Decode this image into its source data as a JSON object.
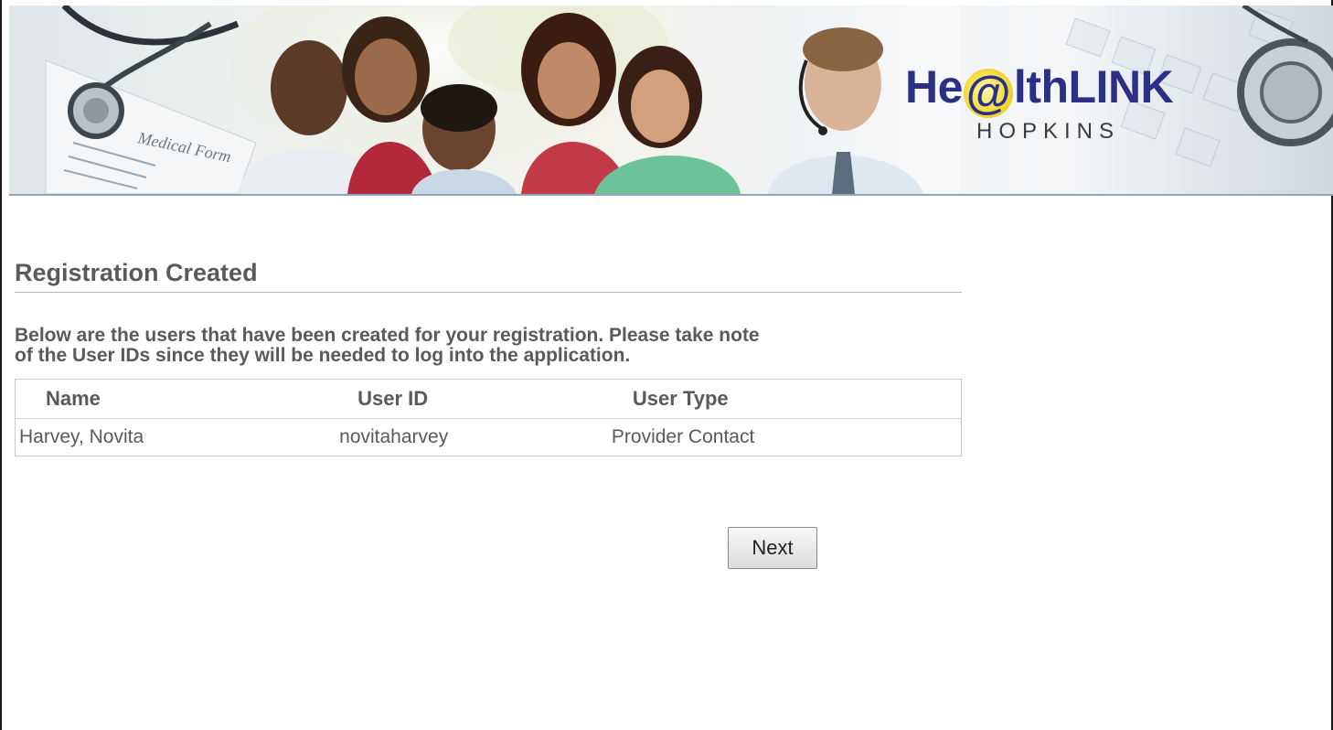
{
  "header": {
    "logo_main_prefix": "He",
    "logo_at": "@",
    "logo_main_suffix": "lthLINK",
    "logo_sub": "HOPKINS",
    "photo_caption": "Medical Form",
    "brand_color": "#2b2f86",
    "accent_color": "#f3da3a"
  },
  "page": {
    "title": "Registration Created",
    "intro_line1": "Below are the users that have been created for your registration. Please take note",
    "intro_line2": "of the User IDs since they will be needed to log into the application."
  },
  "table": {
    "columns": [
      "Name",
      "User ID",
      "User Type"
    ],
    "rows": [
      [
        "Harvey, Novita",
        "novitaharvey",
        "Provider Contact"
      ]
    ]
  },
  "actions": {
    "next_label": "Next"
  }
}
